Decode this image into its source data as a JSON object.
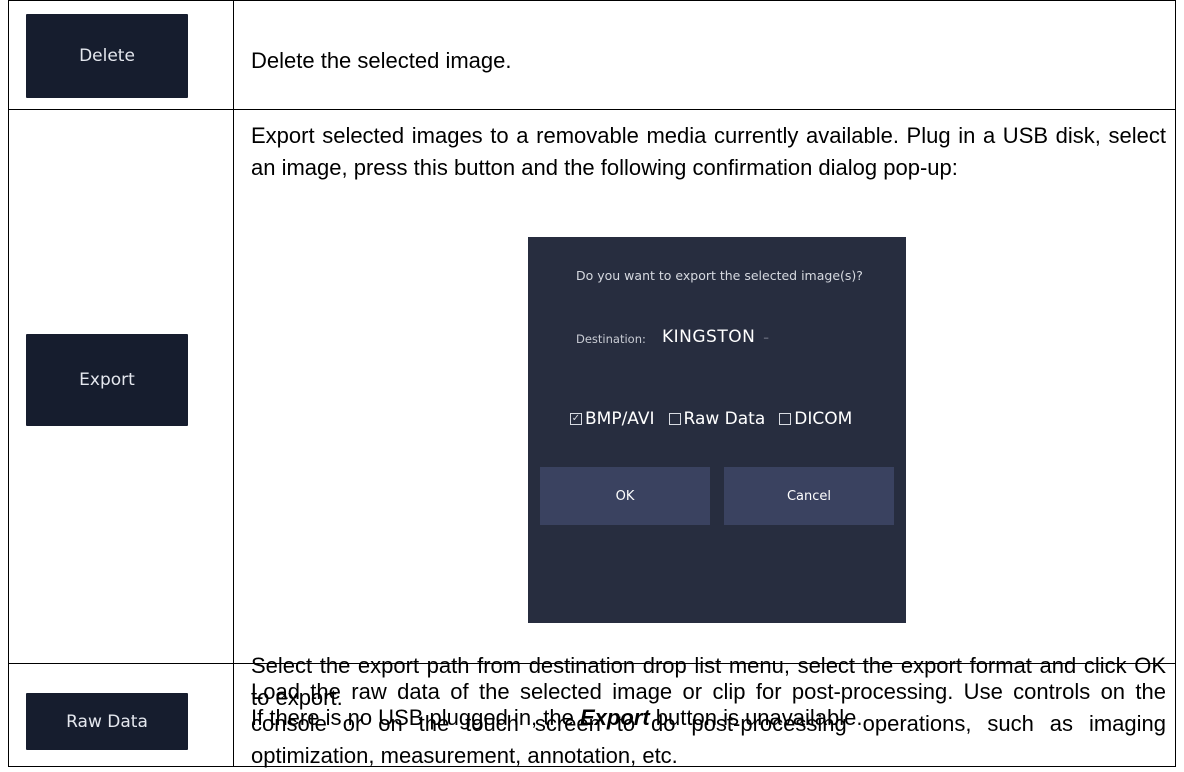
{
  "rows": [
    {
      "button_label": "Delete",
      "description": "Delete the selected image."
    },
    {
      "button_label": "Export",
      "description": "Export selected images to a removable media currently available. Plug in a USB disk, select an image, press this button and the following confirmation dialog pop-up:",
      "after_dialog_1": "Select the export path from destination drop list menu, select the export format and click OK to export.",
      "after_dialog_2_prefix": "If there is no USB plugged in, the ",
      "after_dialog_2_emphasis": "Export",
      "after_dialog_2_suffix": " button is unavailable."
    },
    {
      "button_label": "Raw Data",
      "description": "Load the raw data of the selected image or clip for post-processing. Use controls on the console or on the touch screen to do post-processing operations, such as imaging optimization, measurement, annotation, etc."
    }
  ],
  "export_dialog": {
    "prompt": "Do you want to export the selected image(s)?",
    "destination_label": "Destination:",
    "destination_value": "ΚINGSTON",
    "destination_icon": "chevron-down-icon",
    "formats": [
      {
        "label": "BMP/AVI",
        "checked": true
      },
      {
        "label": "Raw Data",
        "checked": false
      },
      {
        "label": "DICOM",
        "checked": false
      }
    ],
    "ok_label": "OK",
    "cancel_label": "Cancel"
  }
}
